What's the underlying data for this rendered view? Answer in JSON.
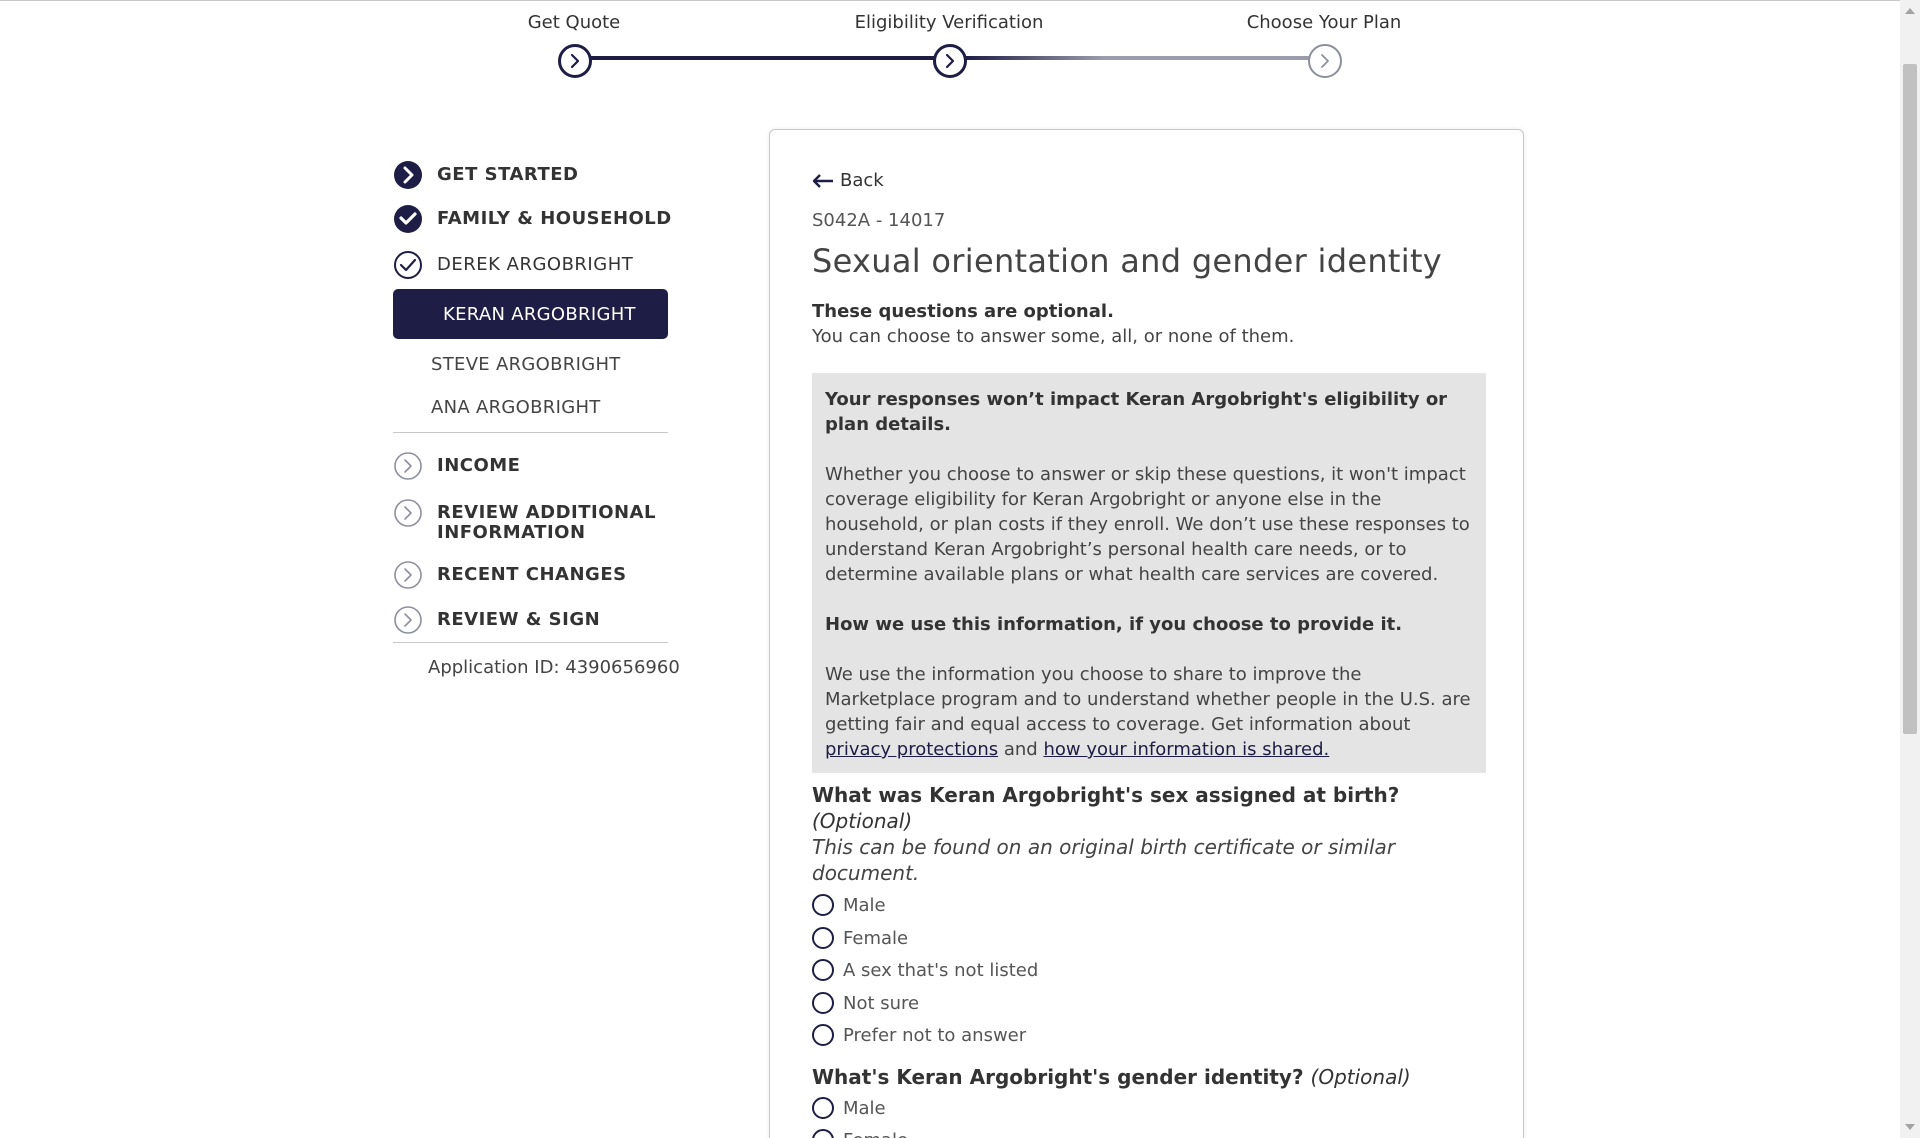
{
  "stepper": {
    "steps": [
      {
        "label": "Get Quote",
        "state": "complete"
      },
      {
        "label": "Eligibility Verification",
        "state": "current"
      },
      {
        "label": "Choose Your Plan",
        "state": "upcoming"
      }
    ]
  },
  "sidebar": {
    "sections": [
      {
        "label": "GET STARTED",
        "icon": "chevron-right-filled-icon"
      },
      {
        "label": "FAMILY & HOUSEHOLD",
        "icon": "check-filled-icon"
      },
      {
        "label": "DEREK ARGOBRIGHT",
        "icon": "check-outline-icon"
      }
    ],
    "members": {
      "active": "KERAN ARGOBRIGHT",
      "others": [
        "STEVE ARGOBRIGHT",
        "ANA ARGOBRIGHT"
      ]
    },
    "later_sections": [
      {
        "label": "INCOME",
        "icon": "chevron-right-outline-icon"
      },
      {
        "label_line1": "REVIEW ADDITIONAL",
        "label_line2": "INFORMATION",
        "icon": "chevron-right-outline-icon"
      },
      {
        "label": "RECENT CHANGES",
        "icon": "chevron-right-outline-icon"
      },
      {
        "label": "REVIEW & SIGN",
        "icon": "chevron-right-outline-icon"
      }
    ],
    "application_id": "Application ID: 4390656960"
  },
  "main": {
    "back_label": "Back",
    "code": "S042A - 14017",
    "title": "Sexual orientation and gender identity",
    "optional_heading": "These questions are optional.",
    "optional_sub": "You can choose to answer some, all, or none of them.",
    "info": {
      "heading1": "Your responses won’t impact Keran Argobright's eligibility or plan details.",
      "para1": "Whether you choose to answer or skip these questions, it won't impact coverage eligibility for Keran Argobright or anyone else in the household, or plan costs if they enroll. We don’t use these responses to understand Keran Argobright’s personal health care needs, or to determine available plans or what health care services are covered.",
      "heading2": "How we use this information, if you choose to provide it.",
      "para2": "We use the information you choose to share to improve the Marketplace program and to understand whether people in the U.S. are getting fair and equal access to coverage. Get information about",
      "link1": "privacy protections",
      "and": "and",
      "link2": "how your information is shared."
    },
    "q1": {
      "question": "What was Keran Argobright's sex assigned at birth?",
      "optional": "(Optional)",
      "hint": "This can be found on an original birth certificate or similar document.",
      "options": [
        "Male",
        "Female",
        "A sex that's not listed",
        "Not sure",
        "Prefer not to answer"
      ]
    },
    "q2": {
      "question": "What's Keran Argobright's gender identity?",
      "optional": "(Optional)",
      "options": [
        "Male",
        "Female"
      ]
    }
  },
  "colors": {
    "brand_navy": "#1e1d45",
    "info_box_bg": "#e4e4e4"
  }
}
